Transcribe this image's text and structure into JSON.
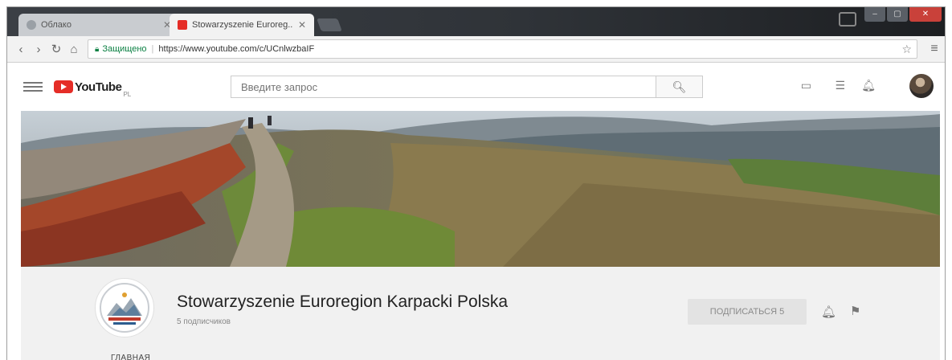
{
  "browser": {
    "tabs": [
      {
        "title": "Облако",
        "active": false
      },
      {
        "title": "Stowarzyszenie Euroreg...",
        "active": true
      }
    ],
    "address": {
      "secure_label": "Защищено",
      "url": "https://www.youtube.com/c/UCnlwzbaIF"
    }
  },
  "youtube": {
    "logo_text": "YouTube",
    "region_code": "PL",
    "search_placeholder": "Введите запрос"
  },
  "channel": {
    "name": "Stowarzyszenie Euroregion Karpacki Polska",
    "subscribers": "5 подписчиков",
    "subscribe_label": "ПОДПИСАТЬСЯ 5",
    "tab_label": "ГЛАВНАЯ"
  },
  "colors": {
    "youtube_red": "#e52d27",
    "secure_green": "#0b8043",
    "channel_bg": "#f1f1f1"
  }
}
